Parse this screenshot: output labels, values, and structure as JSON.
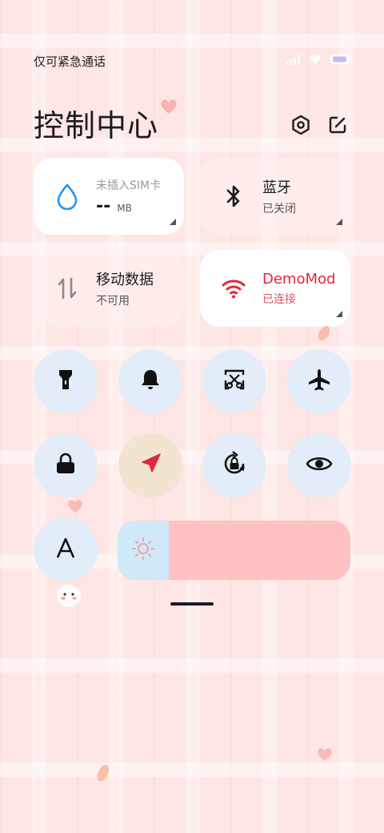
{
  "status_bar": {
    "carrier_text": "仅可紧急通话"
  },
  "header": {
    "title": "控制中心"
  },
  "tiles": {
    "sim": {
      "title": "未插入SIM卡",
      "value": "--",
      "unit": "MB"
    },
    "bluetooth": {
      "title": "蓝牙",
      "subtitle": "已关闭"
    },
    "mobile_data": {
      "title": "移动数据",
      "subtitle": "不可用"
    },
    "wifi": {
      "title": "DemoMod",
      "subtitle": "已连接"
    }
  },
  "toggles": [
    {
      "name": "flashlight",
      "icon": "flashlight-icon",
      "active": false
    },
    {
      "name": "sound",
      "icon": "bell-icon",
      "active": false
    },
    {
      "name": "screenshot",
      "icon": "screenshot-icon",
      "active": false
    },
    {
      "name": "airplane-mode",
      "icon": "airplane-icon",
      "active": false
    },
    {
      "name": "lock-screen",
      "icon": "lock-icon",
      "active": false
    },
    {
      "name": "location",
      "icon": "location-arrow-icon",
      "active": true
    },
    {
      "name": "auto-rotate",
      "icon": "rotate-lock-icon",
      "active": false
    },
    {
      "name": "reading-mode",
      "icon": "eye-icon",
      "active": false
    },
    {
      "name": "font-size",
      "icon": "letter-a-icon",
      "active": false
    }
  ],
  "brightness": {
    "level_fraction": 0.22,
    "icon": "sun-icon"
  },
  "colors": {
    "wifi_active": "#e0283c",
    "water_drop": "#2196f3",
    "location_active": "#e0283c",
    "toggle_bg": "#e2edf9",
    "brightness_track": "#ffc1c4",
    "brightness_fill": "#cfe9f8"
  }
}
